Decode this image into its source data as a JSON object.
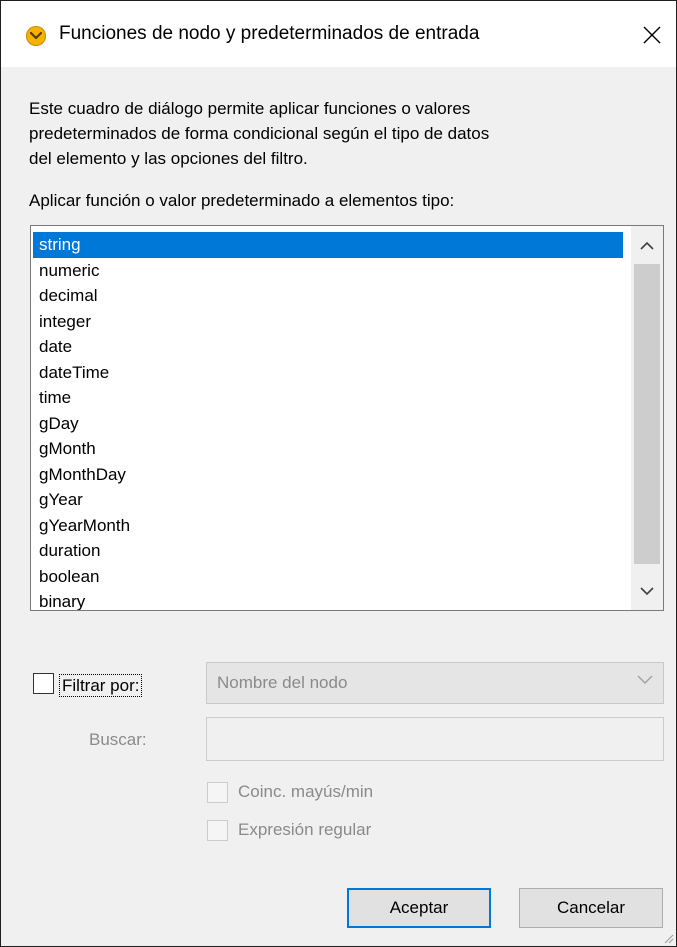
{
  "window": {
    "title": "Funciones de nodo y predeterminados de entrada",
    "icon": "altova-app-icon",
    "close_icon": "close-icon"
  },
  "description": {
    "lines": [
      "Este cuadro de diálogo permite aplicar funciones o valores",
      "predeterminados de forma condicional según el tipo de datos",
      "del elemento y las opciones del filtro."
    ]
  },
  "types_list": {
    "label": "Aplicar función o valor predeterminado a elementos tipo:",
    "selected_index": 0,
    "items": [
      "string",
      "numeric",
      "decimal",
      "integer",
      "date",
      "dateTime",
      "time",
      "gDay",
      "gMonth",
      "gMonthDay",
      "gYear",
      "gYearMonth",
      "duration",
      "boolean",
      "binary"
    ]
  },
  "filter": {
    "checked": false,
    "label": "Filtrar por:",
    "select_value": "Nombre del nodo"
  },
  "search": {
    "label": "Buscar:",
    "value": ""
  },
  "options": {
    "match_case_label": "Coinc. mayús/min",
    "regex_label": "Expresión regular"
  },
  "buttons": {
    "ok": "Aceptar",
    "cancel": "Cancelar"
  },
  "colors": {
    "selection": "#0078d7",
    "icon": "#f5b300",
    "background": "#f0f0f0"
  }
}
